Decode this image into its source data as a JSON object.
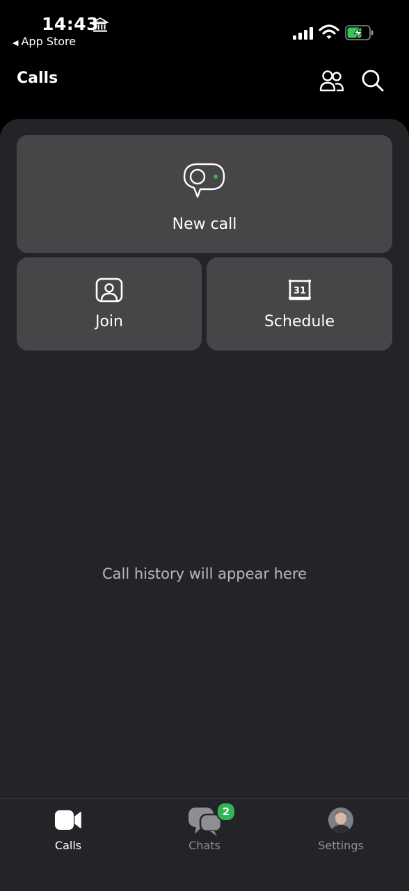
{
  "status_bar": {
    "time": "14:43",
    "back_app": "App Store"
  },
  "header": {
    "title": "Calls"
  },
  "actions": {
    "new_call": "New call",
    "join": "Join",
    "schedule": "Schedule",
    "calendar_day": "31"
  },
  "empty_state": "Call history will appear here",
  "tabbar": {
    "calls": "Calls",
    "chats": "Chats",
    "chats_badge": "2",
    "settings": "Settings"
  },
  "colors": {
    "accent_green": "#2fb553",
    "card": "#464649",
    "panel": "#242428"
  }
}
